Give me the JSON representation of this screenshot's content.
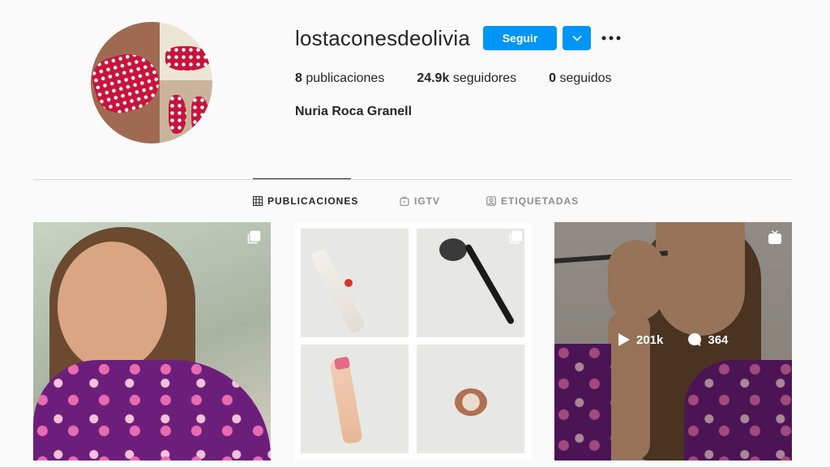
{
  "profile": {
    "username": "lostaconesdeolivia",
    "follow_label": "Seguir",
    "posts_count": "8",
    "posts_label": "publicaciones",
    "followers_count": "24.9k",
    "followers_label": "seguidores",
    "following_count": "0",
    "following_label": "seguidos",
    "full_name": "Nuria Roca Granell"
  },
  "tabs": [
    {
      "label": "PUBLICACIONES",
      "icon": "grid-icon",
      "active": true
    },
    {
      "label": "IGTV",
      "icon": "igtv-icon",
      "active": false
    },
    {
      "label": "ETIQUETADAS",
      "icon": "tagged-icon",
      "active": false
    }
  ],
  "posts": [
    {
      "type": "carousel",
      "icon": "carousel-icon"
    },
    {
      "type": "carousel",
      "icon": "carousel-icon"
    },
    {
      "type": "igtv",
      "icon": "igtv-icon",
      "views": "201k",
      "comments": "364"
    }
  ],
  "colors": {
    "accent": "#0095f6",
    "text": "#262626",
    "muted": "#8e8e8e",
    "background": "#fafafa"
  }
}
